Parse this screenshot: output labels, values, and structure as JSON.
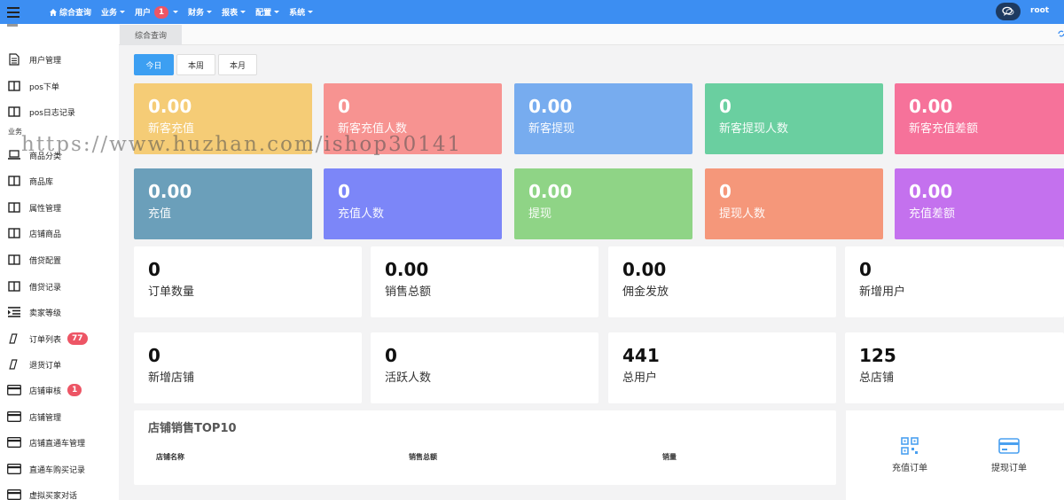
{
  "topnav": {
    "items": [
      {
        "label": "综合查询",
        "caret": false,
        "home": true
      },
      {
        "label": "业务",
        "caret": true
      },
      {
        "label": "用户",
        "caret": true,
        "badge": "1"
      },
      {
        "label": "财务",
        "caret": true
      },
      {
        "label": "报表",
        "caret": true
      },
      {
        "label": "配置",
        "caret": true
      },
      {
        "label": "系统",
        "caret": true
      }
    ],
    "user": "root"
  },
  "sidebar": {
    "section": "业务",
    "items": [
      {
        "label": "用户管理",
        "icon": "document-icon"
      },
      {
        "label": "pos下单",
        "icon": "columns-icon"
      },
      {
        "label": "pos日志记录",
        "icon": "columns-icon"
      },
      {
        "label": "商品分类",
        "icon": "laptop-icon"
      },
      {
        "label": "商品库",
        "icon": "columns-icon"
      },
      {
        "label": "属性管理",
        "icon": "columns-icon"
      },
      {
        "label": "店铺商品",
        "icon": "columns-icon"
      },
      {
        "label": "借贷配置",
        "icon": "columns-icon"
      },
      {
        "label": "借贷记录",
        "icon": "columns-icon"
      },
      {
        "label": "卖家等级",
        "icon": "indent-icon"
      },
      {
        "label": "订单列表",
        "icon": "slash-icon",
        "badge": "77"
      },
      {
        "label": "退货订单",
        "icon": "slash-icon"
      },
      {
        "label": "店铺审核",
        "icon": "card-icon",
        "badge": "1"
      },
      {
        "label": "店铺管理",
        "icon": "card-icon"
      },
      {
        "label": "店铺直通车管理",
        "icon": "card-icon"
      },
      {
        "label": "直通车购买记录",
        "icon": "card-icon"
      },
      {
        "label": "虚拟买家对话",
        "icon": "card-icon"
      }
    ]
  },
  "tabs": {
    "active": "综合查询"
  },
  "period": {
    "today": "今日",
    "week": "本周",
    "month": "本月"
  },
  "cards_row1": [
    {
      "value": "0.00",
      "label": "新客充值",
      "color": "#f5cc76"
    },
    {
      "value": "0",
      "label": "新客充值人数",
      "color": "#f79391"
    },
    {
      "value": "0.00",
      "label": "新客提现",
      "color": "#77acef"
    },
    {
      "value": "0",
      "label": "新客提现人数",
      "color": "#6acfa0"
    },
    {
      "value": "0.00",
      "label": "新客充值差额",
      "color": "#f6729a"
    }
  ],
  "cards_row2": [
    {
      "value": "0.00",
      "label": "充值",
      "color": "#6b9fba"
    },
    {
      "value": "0",
      "label": "充值人数",
      "color": "#7c86f8"
    },
    {
      "value": "0.00",
      "label": "提现",
      "color": "#8fd486"
    },
    {
      "value": "0",
      "label": "提现人数",
      "color": "#f5977a"
    },
    {
      "value": "0.00",
      "label": "充值差额",
      "color": "#c471ee"
    }
  ],
  "cards_row3": [
    {
      "value": "0",
      "label": "订单数量"
    },
    {
      "value": "0.00",
      "label": "销售总额"
    },
    {
      "value": "0.00",
      "label": "佣金发放"
    },
    {
      "value": "0",
      "label": "新增用户"
    }
  ],
  "cards_row4": [
    {
      "value": "0",
      "label": "新增店铺"
    },
    {
      "value": "0",
      "label": "活跃人数"
    },
    {
      "value": "441",
      "label": "总用户"
    },
    {
      "value": "125",
      "label": "总店铺"
    }
  ],
  "top10": {
    "title": "店铺销售TOP10",
    "columns": [
      "店铺名称",
      "销售总额",
      "销量"
    ]
  },
  "quick": {
    "recharge": "充值订单",
    "withdraw": "提现订单"
  },
  "watermark": "https://www.huzhan.com/ishop30141"
}
